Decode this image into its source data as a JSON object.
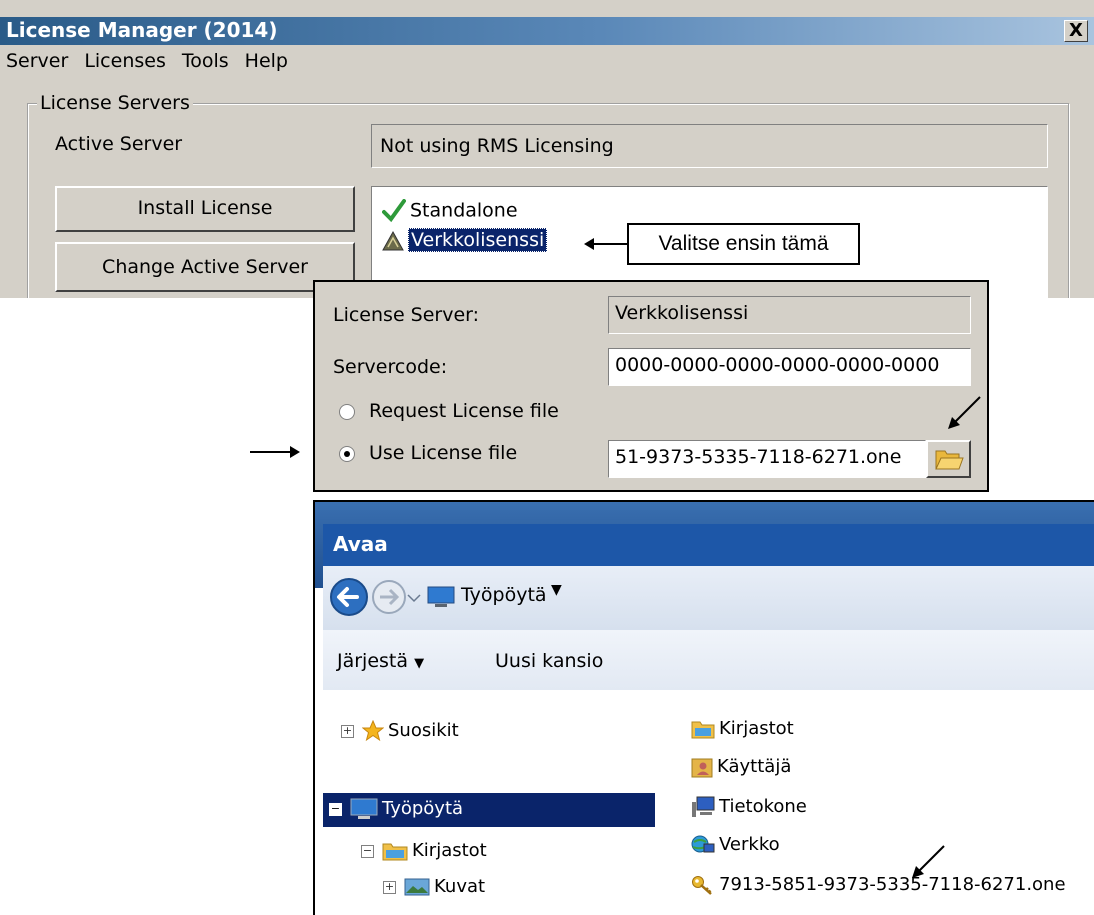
{
  "license_manager": {
    "title": "License Manager (2014)",
    "close_label": "X",
    "menu": [
      "Server",
      "Licenses",
      "Tools",
      "Help"
    ],
    "group_label": "License Servers",
    "active_server_label": "Active Server",
    "active_server_value": "Not using RMS Licensing",
    "install_button": "Install License",
    "change_button": "Change Active Server",
    "servers": [
      "Standalone",
      "Verkkolisenssi"
    ],
    "selected_server": "Verkkolisenssi"
  },
  "annotation": {
    "callout": "Valitse ensin tämä"
  },
  "license_panel": {
    "server_label": "License Server:",
    "server_value": "Verkkolisenssi",
    "code_label": "Servercode:",
    "code_value": "0000-0000-0000-0000-0000-0000",
    "request_label": "Request License file",
    "use_label": "Use License file",
    "file_value": "51-9373-5335-7118-6271.one",
    "selected_option": "Use License file"
  },
  "open_dialog": {
    "title": "Avaa",
    "location": "Työpöytä",
    "organize_label": "Järjestä",
    "new_folder_label": "Uusi kansio",
    "nav": {
      "favorites": "Suosikit",
      "desktop": "Työpöytä",
      "libraries": "Kirjastot",
      "pictures": "Kuvat"
    },
    "files": [
      "Kirjastot",
      "Käyttäjä",
      "Tietokone",
      "Verkko",
      "7913-5851-9373-5335-7118-6271.one"
    ]
  },
  "colors": {
    "dialog_gray": "#d4d0c8",
    "selection_blue": "#0a246a",
    "title_blue": "#1d57a8"
  }
}
